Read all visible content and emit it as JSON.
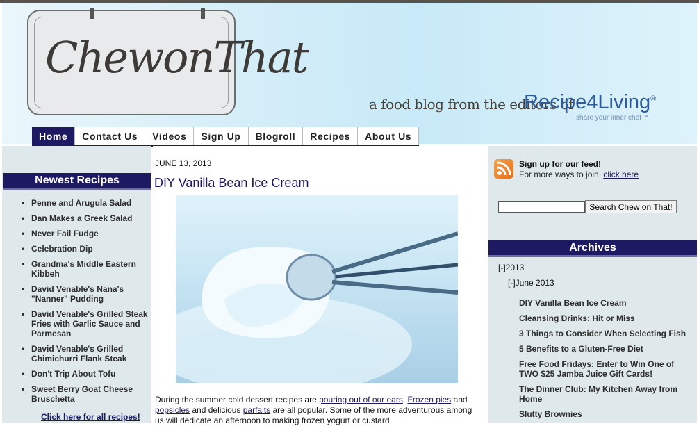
{
  "header": {
    "logo_text": "ChewonThat",
    "tagline": "a food blog from the editors of",
    "brand_name": "Recipe4Living",
    "brand_mark": "®",
    "brand_slogan": "share your inner chef™"
  },
  "nav": {
    "items": [
      {
        "label": "Home"
      },
      {
        "label": "Contact Us"
      },
      {
        "label": "Videos"
      },
      {
        "label": "Sign Up"
      },
      {
        "label": "Blogroll"
      },
      {
        "label": "Recipes"
      },
      {
        "label": "About Us"
      }
    ]
  },
  "left_sidebar": {
    "heading": "Newest Recipes",
    "items": [
      "Penne and Arugula Salad",
      "Dan Makes a Greek Salad",
      "Never Fail Fudge",
      "Celebration Dip",
      "Grandma's Middle Eastern Kibbeh",
      "David Venable's Nana's \"Nanner\" Pudding",
      "David Venable's Grilled Steak Fries with Garlic Sauce and Parmesan",
      "David Venable's Grilled Chimichurri Flank Steak",
      "Don't Trip About Tofu",
      "Sweet Berry Goat Cheese Bruschetta"
    ],
    "all_link": "Click here for all recipes!"
  },
  "post": {
    "date": "JUNE 13, 2013",
    "title": "DIY Vanilla Bean Ice Cream",
    "body": {
      "t1": "During the summer cold dessert recipes are ",
      "l1": "pouring out of our ears",
      "t2": ". ",
      "l2": "Frozen pies",
      "t3": " and ",
      "l3": "popsicles",
      "t4": " and delicious ",
      "l4": "parfaits",
      "t5": " are all popular. Some of the more adventurous among us will dedicate an afternoon to making frozen yogurt or custard"
    }
  },
  "right_sidebar": {
    "feed_title": "Sign up for our feed!",
    "feed_text": "For more ways to join, ",
    "feed_link": "click here",
    "search_value": "",
    "search_button": "Search Chew on That!",
    "archives_heading": "Archives",
    "year": "[-]2013",
    "month": "[-]June 2013",
    "posts": [
      "DIY Vanilla Bean Ice Cream",
      "Cleansing Drinks: Hit or Miss",
      "3 Things to Consider When Selecting Fish",
      "5 Benefits to a Gluten-Free Diet",
      "Free Food Fridays: Enter to Win One of TWO $25 Jamba Juice Gift Cards!",
      "The Dinner Club: My Kitchen Away from Home",
      "Slutty Brownies"
    ]
  },
  "colors": {
    "nav_active": "#1d1a63",
    "sidebar_bg": "#dfe9ec",
    "brand_blue": "#2f5d9c",
    "logo_red": "#c23a2a"
  },
  "icons": {
    "rss": "rss-feed-icon"
  }
}
